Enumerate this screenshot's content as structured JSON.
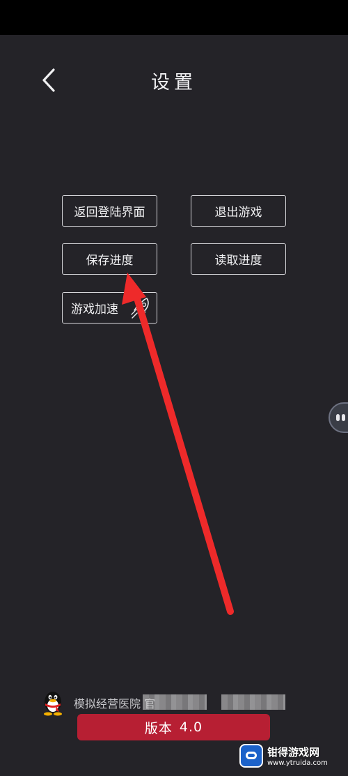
{
  "header": {
    "title": "设置",
    "back_icon": "chevron-left-icon"
  },
  "menu": {
    "return_login": "返回登陆界面",
    "exit_game": "退出游戏",
    "save_progress": "保存进度",
    "load_progress": "读取进度",
    "game_speedup": "游戏加速",
    "speedup_icon": "rocket-icon"
  },
  "side_handle": {
    "icon": "floating-assistant-icon"
  },
  "annotation": {
    "icon": "red-arrow-icon",
    "color": "#ee2a2a"
  },
  "footer": {
    "qq_icon": "qq-penguin-icon",
    "group_text": "模拟经营医院 官",
    "version_label": "版本",
    "version_number": "4.0",
    "version_bar_color": "#b71f33"
  },
  "watermark": {
    "title": "钳得游戏网",
    "url": "www.ytruida.com"
  },
  "colors": {
    "background": "#242328",
    "status_bar": "#000000",
    "button_border": "#d6d6da"
  }
}
